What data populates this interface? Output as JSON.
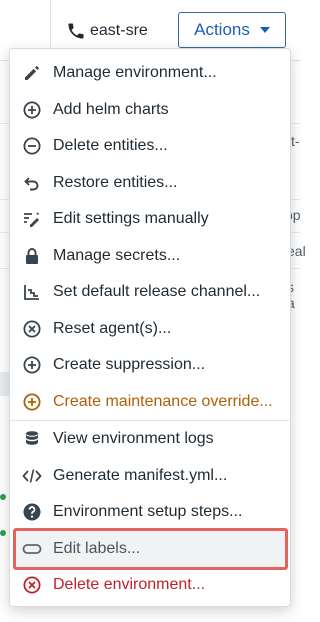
{
  "header": {
    "environment_name": "east-sre",
    "actions_label": "Actions"
  },
  "background": {
    "frag1": "st-",
    "frag2": "op",
    "frag3": "eal",
    "frag4": "s a"
  },
  "menu": {
    "items": [
      {
        "label": "Manage environment...",
        "icon": "pencil-icon"
      },
      {
        "label": "Add helm charts",
        "icon": "plus-circle-icon"
      },
      {
        "label": "Delete entities...",
        "icon": "minus-circle-icon"
      },
      {
        "label": "Restore entities...",
        "icon": "undo-icon"
      },
      {
        "label": "Edit settings manually",
        "icon": "edit-settings-icon"
      },
      {
        "label": "Manage secrets...",
        "icon": "lock-icon"
      },
      {
        "label": "Set default release channel...",
        "icon": "release-channel-icon"
      },
      {
        "label": "Reset agent(s)...",
        "icon": "x-circle-icon"
      },
      {
        "label": "Create suppression...",
        "icon": "plus-circle-icon"
      },
      {
        "label": "Create maintenance override...",
        "icon": "plus-circle-icon"
      },
      {
        "label": "View environment logs",
        "icon": "database-icon"
      },
      {
        "label": "Generate manifest.yml...",
        "icon": "code-icon"
      },
      {
        "label": "Environment setup steps...",
        "icon": "help-icon"
      },
      {
        "label": "Edit labels...",
        "icon": "label-icon"
      },
      {
        "label": "Delete environment...",
        "icon": "x-circle-icon"
      }
    ]
  },
  "colors": {
    "accent": "#1d5fb6",
    "warning": "#b25e09",
    "danger": "#c2202a",
    "highlight_border": "#e2645c"
  }
}
